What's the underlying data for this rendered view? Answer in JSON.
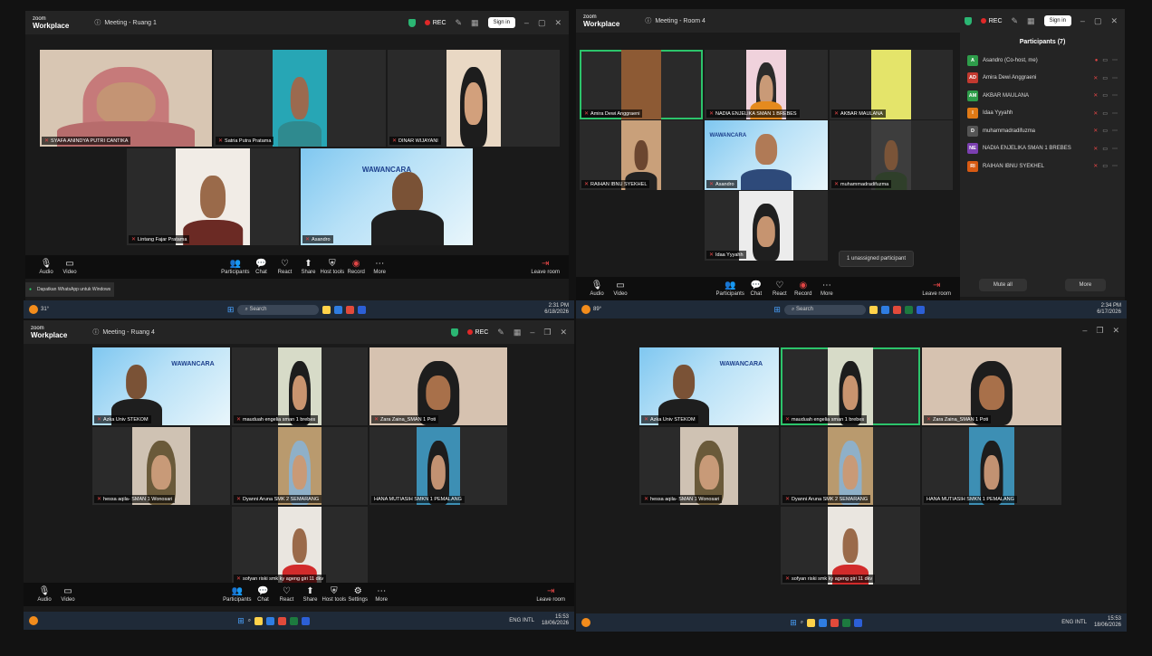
{
  "q1": {
    "brand_top": "zoom",
    "brand_bottom": "Workplace",
    "title": "Meeting - Ruang 1",
    "rec": "REC",
    "signin": "Sign in",
    "participants_count": "5",
    "tiles": [
      {
        "name": "SYAFA ANINDYA PUTRI CANTIKA"
      },
      {
        "name": "Satria Putra Pratama"
      },
      {
        "name": "DINAR WIJAYANI"
      },
      {
        "name": "Lintang Fajar Pratama"
      },
      {
        "name": "Asandro"
      }
    ],
    "toolbar": {
      "audio": "Audio",
      "video": "Video",
      "participants": "Participants",
      "chat": "Chat",
      "react": "React",
      "share": "Share",
      "host_tools": "Host tools",
      "record": "Record",
      "more": "More",
      "leave": "Leave room"
    },
    "wa_text": "Dapatkan WhatsApp untuk Windows",
    "taskbar": {
      "search": "Search",
      "time": "2:31 PM",
      "date": "6/18/2026",
      "temp": "31°"
    }
  },
  "q2": {
    "brand_top": "zoom",
    "brand_bottom": "Workplace",
    "title": "Meeting - Room 4",
    "rec": "REC",
    "signin": "Sign in",
    "participants_count": "7",
    "tiles": [
      {
        "name": "Amira Dewi Anggraeni"
      },
      {
        "name": "NADIA ENJELIKA SMAN 1 BREBES"
      },
      {
        "name": "AKBAR MAULANA"
      },
      {
        "name": "RAIHAN IBNU SYEKHEL"
      },
      {
        "name": "Asandro"
      },
      {
        "name": "muhammadradifuzma"
      },
      {
        "name": "Idaa Yyyahh"
      }
    ],
    "tooltip": "1 unassigned participant",
    "panel": {
      "title": "Participants (7)",
      "people": [
        {
          "initials": "A",
          "name": "Asandro (Co-host, me)",
          "color": "#2e9d4a"
        },
        {
          "initials": "AD",
          "name": "Amira Dewi Anggraeni",
          "color": "#c2392f"
        },
        {
          "initials": "AM",
          "name": "AKBAR MAULANA",
          "color": "#2e9d4a"
        },
        {
          "initials": "I",
          "name": "Idaa Yyyahh",
          "color": "#e07a16"
        },
        {
          "initials": "D",
          "name": "muhammadradifuzma",
          "color": "#555555"
        },
        {
          "initials": "NE",
          "name": "NADIA ENJELIKA SMAN 1 BREBES",
          "color": "#7b3fb0"
        },
        {
          "initials": "RI",
          "name": "RAIHAN IBNU SYEKHEL",
          "color": "#d85a12"
        }
      ],
      "mute_all": "Mute all",
      "more": "More"
    },
    "toolbar": {
      "audio": "Audio",
      "video": "Video",
      "participants": "Participants",
      "chat": "Chat",
      "react": "React",
      "record": "Record",
      "more": "More",
      "leave": "Leave room"
    },
    "taskbar": {
      "search": "Search",
      "time": "2:34 PM",
      "date": "6/17/2026",
      "temp": "89°"
    }
  },
  "q3": {
    "brand_top": "zoom",
    "brand_bottom": "Workplace",
    "title": "Meeting - Ruang 4",
    "rec": "REC",
    "participants_count": "7",
    "tiles": [
      {
        "name": "Azka Univ STEKOM"
      },
      {
        "name": "mauduah engelia sman 1 brebes"
      },
      {
        "name": "Zara Zaina_SMAN 1 Poti"
      },
      {
        "name": "hessa aqila- SMAN 1 Wonosari"
      },
      {
        "name": "Dyanni Aruna SMK 2 SEMARANG"
      },
      {
        "name": "HANA MUTIASIH SMKN 1 PEMALANG"
      },
      {
        "name": "sofyan riski smk ky ageng giri 11 dkv"
      }
    ],
    "toolbar": {
      "audio": "Audio",
      "video": "Video",
      "participants": "Participants",
      "chat": "Chat",
      "react": "React",
      "share": "Share",
      "host_tools": "Host tools",
      "settings": "Settings",
      "more": "More",
      "leave": "Leave room"
    },
    "taskbar": {
      "lang": "ENG INTL",
      "time": "15:53",
      "date": "18/06/2026"
    }
  },
  "q4": {
    "tiles": [
      {
        "name": "Azka Univ STEKOM"
      },
      {
        "name": "mauduah engelia sman 1 brebes"
      },
      {
        "name": "Zara Zaina_SMAN 1 Poti"
      },
      {
        "name": "hessa aqila- SMAN 1 Wonosari"
      },
      {
        "name": "Dyanni Aruna SMK 2 SEMARANG"
      },
      {
        "name": "HANA MUTIASIH SMKN 1 PEMALANG"
      },
      {
        "name": "sofyan riski smk ky ageng giri 11 dkv"
      }
    ],
    "taskbar": {
      "lang": "ENG INTL",
      "time": "15:53",
      "date": "18/06/2026"
    }
  },
  "colors": {
    "highlight": "#2cc46b",
    "rec": "#e02828",
    "toolbar": "#0e0e0e",
    "taskbar": "#1f2a38"
  }
}
